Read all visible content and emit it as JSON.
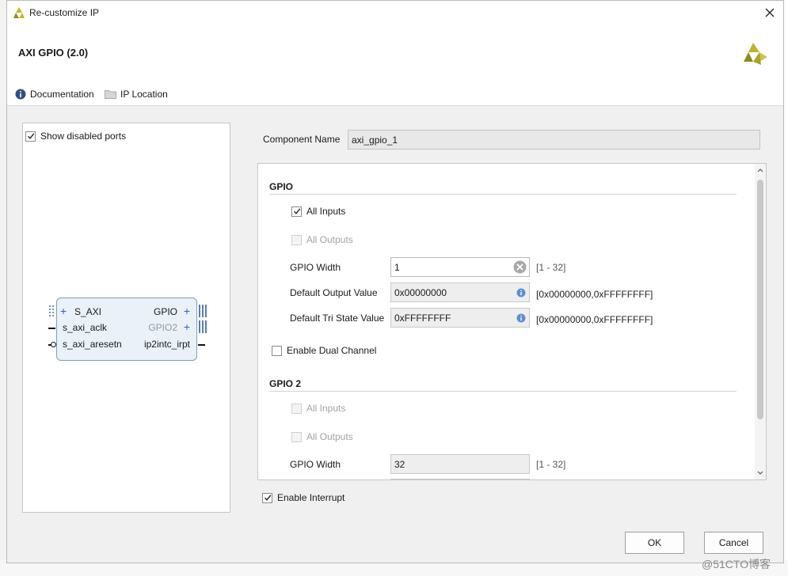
{
  "window": {
    "title": "Re-customize IP"
  },
  "header": {
    "title": "AXI GPIO (2.0)",
    "links": {
      "documentation": "Documentation",
      "ip_location": "IP Location"
    }
  },
  "left_pane": {
    "show_disabled_ports": {
      "label": "Show disabled ports",
      "checked": true
    },
    "ports": {
      "s_axi": "S_AXI",
      "s_axi_aclk": "s_axi_aclk",
      "s_axi_aresetn": "s_axi_aresetn",
      "gpio": "GPIO",
      "gpio2": "GPIO2",
      "ip2intc_irpt": "ip2intc_irpt"
    }
  },
  "component": {
    "label": "Component Name",
    "value": "axi_gpio_1"
  },
  "gpio": {
    "title": "GPIO",
    "all_inputs": {
      "label": "All Inputs",
      "checked": true
    },
    "all_outputs": {
      "label": "All Outputs",
      "checked": false
    },
    "width": {
      "label": "GPIO Width",
      "value": "1",
      "range": "[1 - 32]"
    },
    "default_output": {
      "label": "Default Output Value",
      "value": "0x00000000",
      "range": "[0x00000000,0xFFFFFFFF]"
    },
    "default_tri": {
      "label": "Default Tri State Value",
      "value": "0xFFFFFFFF",
      "range": "[0x00000000,0xFFFFFFFF]"
    },
    "enable_dual": {
      "label": "Enable Dual Channel",
      "checked": false
    }
  },
  "gpio2": {
    "title": "GPIO 2",
    "all_inputs": {
      "label": "All Inputs",
      "checked": false
    },
    "all_outputs": {
      "label": "All Outputs",
      "checked": false
    },
    "width": {
      "label": "GPIO Width",
      "value": "32",
      "range": "[1 - 32]"
    }
  },
  "enable_interrupt": {
    "label": "Enable Interrupt",
    "checked": true
  },
  "buttons": {
    "ok": "OK",
    "cancel": "Cancel"
  },
  "watermark": "@51CTO博客",
  "icons": {
    "app": "xilinx-logo-icon",
    "close": "close-icon",
    "info": "info-icon",
    "folder": "folder-icon",
    "clear": "clear-icon",
    "scroll_up": "chevron-up-icon",
    "scroll_down": "chevron-down-icon"
  },
  "colors": {
    "info_blue": "#2e62b8",
    "accent_logo": "#9c9c2a",
    "block_fill": "#eaf1f9"
  }
}
